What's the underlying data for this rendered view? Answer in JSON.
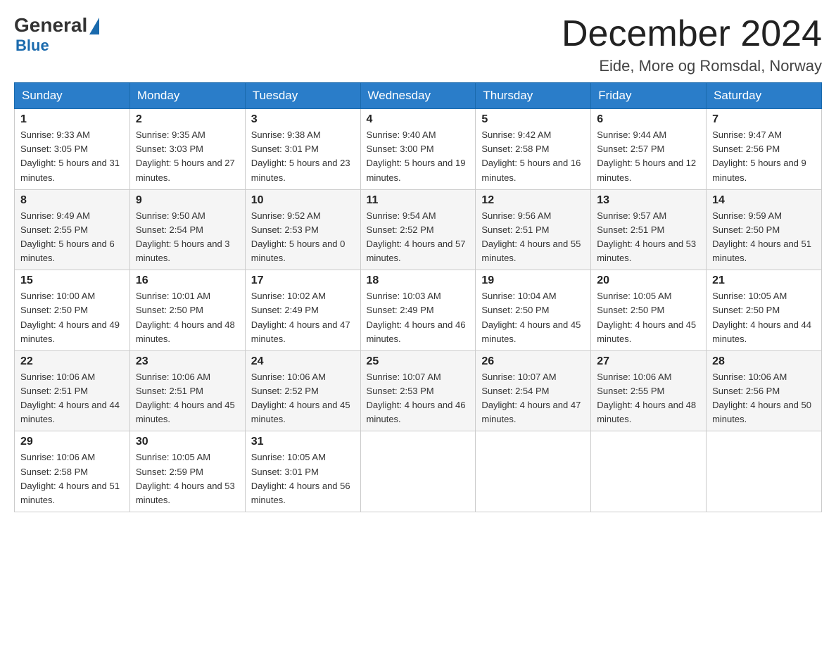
{
  "header": {
    "logo": {
      "general_text": "General",
      "blue_text": "Blue"
    },
    "title": "December 2024",
    "location": "Eide, More og Romsdal, Norway"
  },
  "days_of_week": [
    "Sunday",
    "Monday",
    "Tuesday",
    "Wednesday",
    "Thursday",
    "Friday",
    "Saturday"
  ],
  "weeks": [
    [
      {
        "day": "1",
        "sunrise": "9:33 AM",
        "sunset": "3:05 PM",
        "daylight": "5 hours and 31 minutes."
      },
      {
        "day": "2",
        "sunrise": "9:35 AM",
        "sunset": "3:03 PM",
        "daylight": "5 hours and 27 minutes."
      },
      {
        "day": "3",
        "sunrise": "9:38 AM",
        "sunset": "3:01 PM",
        "daylight": "5 hours and 23 minutes."
      },
      {
        "day": "4",
        "sunrise": "9:40 AM",
        "sunset": "3:00 PM",
        "daylight": "5 hours and 19 minutes."
      },
      {
        "day": "5",
        "sunrise": "9:42 AM",
        "sunset": "2:58 PM",
        "daylight": "5 hours and 16 minutes."
      },
      {
        "day": "6",
        "sunrise": "9:44 AM",
        "sunset": "2:57 PM",
        "daylight": "5 hours and 12 minutes."
      },
      {
        "day": "7",
        "sunrise": "9:47 AM",
        "sunset": "2:56 PM",
        "daylight": "5 hours and 9 minutes."
      }
    ],
    [
      {
        "day": "8",
        "sunrise": "9:49 AM",
        "sunset": "2:55 PM",
        "daylight": "5 hours and 6 minutes."
      },
      {
        "day": "9",
        "sunrise": "9:50 AM",
        "sunset": "2:54 PM",
        "daylight": "5 hours and 3 minutes."
      },
      {
        "day": "10",
        "sunrise": "9:52 AM",
        "sunset": "2:53 PM",
        "daylight": "5 hours and 0 minutes."
      },
      {
        "day": "11",
        "sunrise": "9:54 AM",
        "sunset": "2:52 PM",
        "daylight": "4 hours and 57 minutes."
      },
      {
        "day": "12",
        "sunrise": "9:56 AM",
        "sunset": "2:51 PM",
        "daylight": "4 hours and 55 minutes."
      },
      {
        "day": "13",
        "sunrise": "9:57 AM",
        "sunset": "2:51 PM",
        "daylight": "4 hours and 53 minutes."
      },
      {
        "day": "14",
        "sunrise": "9:59 AM",
        "sunset": "2:50 PM",
        "daylight": "4 hours and 51 minutes."
      }
    ],
    [
      {
        "day": "15",
        "sunrise": "10:00 AM",
        "sunset": "2:50 PM",
        "daylight": "4 hours and 49 minutes."
      },
      {
        "day": "16",
        "sunrise": "10:01 AM",
        "sunset": "2:50 PM",
        "daylight": "4 hours and 48 minutes."
      },
      {
        "day": "17",
        "sunrise": "10:02 AM",
        "sunset": "2:49 PM",
        "daylight": "4 hours and 47 minutes."
      },
      {
        "day": "18",
        "sunrise": "10:03 AM",
        "sunset": "2:49 PM",
        "daylight": "4 hours and 46 minutes."
      },
      {
        "day": "19",
        "sunrise": "10:04 AM",
        "sunset": "2:50 PM",
        "daylight": "4 hours and 45 minutes."
      },
      {
        "day": "20",
        "sunrise": "10:05 AM",
        "sunset": "2:50 PM",
        "daylight": "4 hours and 45 minutes."
      },
      {
        "day": "21",
        "sunrise": "10:05 AM",
        "sunset": "2:50 PM",
        "daylight": "4 hours and 44 minutes."
      }
    ],
    [
      {
        "day": "22",
        "sunrise": "10:06 AM",
        "sunset": "2:51 PM",
        "daylight": "4 hours and 44 minutes."
      },
      {
        "day": "23",
        "sunrise": "10:06 AM",
        "sunset": "2:51 PM",
        "daylight": "4 hours and 45 minutes."
      },
      {
        "day": "24",
        "sunrise": "10:06 AM",
        "sunset": "2:52 PM",
        "daylight": "4 hours and 45 minutes."
      },
      {
        "day": "25",
        "sunrise": "10:07 AM",
        "sunset": "2:53 PM",
        "daylight": "4 hours and 46 minutes."
      },
      {
        "day": "26",
        "sunrise": "10:07 AM",
        "sunset": "2:54 PM",
        "daylight": "4 hours and 47 minutes."
      },
      {
        "day": "27",
        "sunrise": "10:06 AM",
        "sunset": "2:55 PM",
        "daylight": "4 hours and 48 minutes."
      },
      {
        "day": "28",
        "sunrise": "10:06 AM",
        "sunset": "2:56 PM",
        "daylight": "4 hours and 50 minutes."
      }
    ],
    [
      {
        "day": "29",
        "sunrise": "10:06 AM",
        "sunset": "2:58 PM",
        "daylight": "4 hours and 51 minutes."
      },
      {
        "day": "30",
        "sunrise": "10:05 AM",
        "sunset": "2:59 PM",
        "daylight": "4 hours and 53 minutes."
      },
      {
        "day": "31",
        "sunrise": "10:05 AM",
        "sunset": "3:01 PM",
        "daylight": "4 hours and 56 minutes."
      },
      null,
      null,
      null,
      null
    ]
  ]
}
